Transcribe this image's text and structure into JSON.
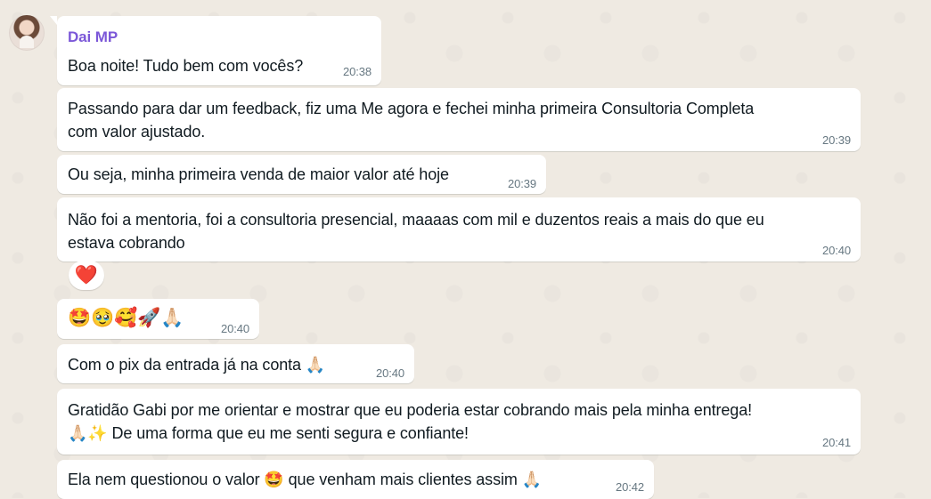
{
  "chat": {
    "sender": "Dai MP",
    "reaction": "❤️",
    "messages": [
      {
        "id": "m1",
        "lines": [
          "Boa noite! Tudo bem com vocês?"
        ],
        "time": "20:38"
      },
      {
        "id": "m2",
        "lines": [
          "Passando para dar um feedback, fiz uma Me agora e fechei minha primeira Consultoria Completa",
          "com valor ajustado."
        ],
        "time": "20:39"
      },
      {
        "id": "m3",
        "lines": [
          "Ou seja, minha primeira venda de maior valor até hoje"
        ],
        "time": "20:39"
      },
      {
        "id": "m4",
        "lines": [
          "Não foi a mentoria, foi a consultoria presencial, maaaas com mil e duzentos reais a mais do que eu",
          "estava cobrando"
        ],
        "time": "20:40"
      },
      {
        "id": "m5",
        "lines": [
          "🤩🥹🥰🚀🙏🏻"
        ],
        "time": "20:40"
      },
      {
        "id": "m6",
        "lines": [
          "Com o pix da entrada já na conta 🙏🏻"
        ],
        "time": "20:40"
      },
      {
        "id": "m7",
        "lines": [
          "Gratidão Gabi por me orientar e mostrar que eu poderia estar cobrando mais pela minha entrega!",
          "🙏🏻✨  De uma forma que eu me senti segura e confiante!"
        ],
        "time": "20:41"
      },
      {
        "id": "m8",
        "lines": [
          "Ela nem questionou o valor 🤩 que venham mais clientes assim 🙏🏻"
        ],
        "time": "20:42"
      }
    ]
  }
}
